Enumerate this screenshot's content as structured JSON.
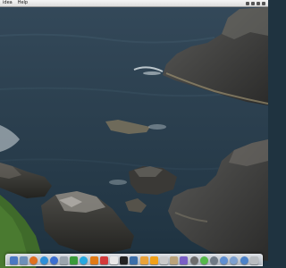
{
  "menubar": {
    "app_menu": "idea",
    "help_menu": "Help"
  },
  "dock": {
    "items": [
      {
        "icon": "finder-icon",
        "color": "#4a78c2"
      },
      {
        "icon": "mail-icon",
        "color": "#6c8fb8"
      },
      {
        "icon": "firefox-icon",
        "color": "#e0701f"
      },
      {
        "icon": "safari-icon",
        "color": "#2f8fd8"
      },
      {
        "icon": "itunes-icon",
        "color": "#3b6fd0"
      },
      {
        "icon": "app-store-icon",
        "color": "#9aa4ad"
      },
      {
        "icon": "facetime-icon",
        "color": "#3a9a3a"
      },
      {
        "icon": "skype-icon",
        "color": "#27a8e0"
      },
      {
        "icon": "vlc-icon",
        "color": "#e07a16"
      },
      {
        "icon": "photos-icon",
        "color": "#d23a3a"
      },
      {
        "icon": "textedit-icon",
        "color": "#e8e8e8"
      },
      {
        "icon": "terminal-icon",
        "color": "#222222"
      },
      {
        "icon": "preview-icon",
        "color": "#3c6ea8"
      },
      {
        "icon": "folder-icon",
        "color": "#e8a23a"
      },
      {
        "icon": "notes-icon",
        "color": "#f0a018"
      },
      {
        "icon": "calendar-icon",
        "color": "#c9c9c9"
      },
      {
        "icon": "image-capture-icon",
        "color": "#b9a27a"
      },
      {
        "icon": "itunes-store-icon",
        "color": "#7a5fc4"
      },
      {
        "icon": "dashboard-icon",
        "color": "#6d6d6d"
      },
      {
        "icon": "messages-icon",
        "color": "#55b84a"
      },
      {
        "icon": "system-preferences-icon",
        "color": "#6f7a86"
      },
      {
        "icon": "downloads-icon",
        "color": "#5f8fd1"
      },
      {
        "icon": "documents-icon",
        "color": "#7da0cf"
      },
      {
        "icon": "applications-icon",
        "color": "#4c82c8"
      },
      {
        "icon": "trash-icon",
        "color": "#b8bcc0"
      }
    ]
  }
}
